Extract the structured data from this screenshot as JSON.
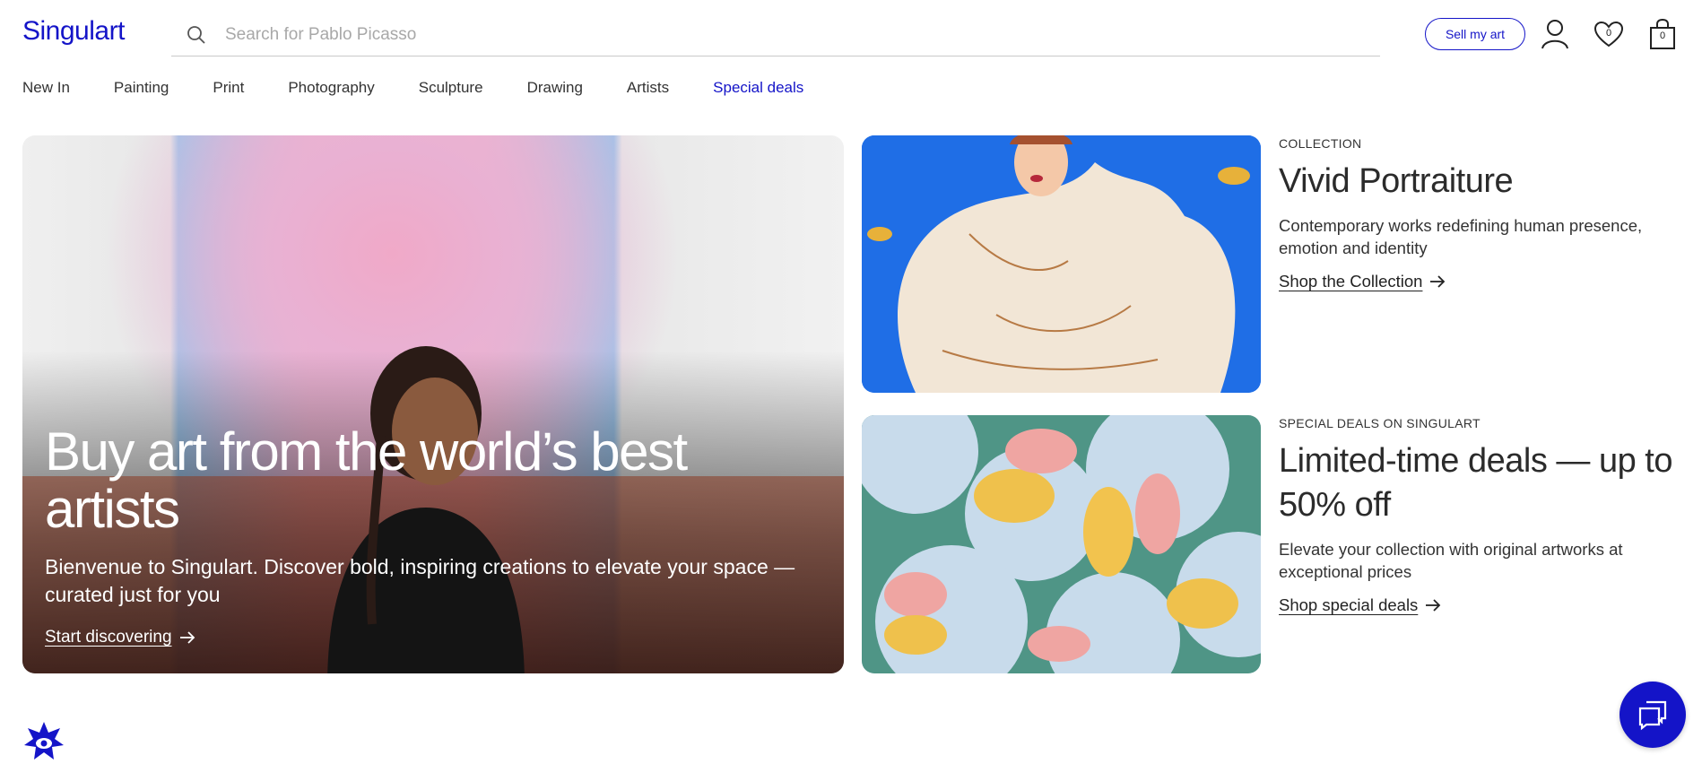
{
  "header": {
    "logo": "Singulart",
    "search_placeholder": "Search for Pablo Picasso",
    "sell_label": "Sell my art",
    "wishlist_count": "0",
    "cart_count": "0"
  },
  "nav": {
    "items": [
      "New In",
      "Painting",
      "Print",
      "Photography",
      "Sculpture",
      "Drawing",
      "Artists",
      "Special deals"
    ]
  },
  "hero": {
    "title": "Buy art from the world’s best artists",
    "subtitle": "Bienvenue to Singulart. Discover bold, inspiring creations to elevate your space —curated just for you",
    "link": "Start discovering"
  },
  "cards": [
    {
      "eyebrow": "COLLECTION",
      "title": "Vivid Portraiture",
      "description": "Contemporary works redefining human presence, emotion and identity",
      "link": "Shop the Collection"
    },
    {
      "eyebrow": "SPECIAL DEALS ON SINGULART",
      "title": "Limited-time deals — up to 50% off",
      "description": "Elevate your collection with original artworks at exceptional prices",
      "link": "Shop special deals"
    }
  ],
  "colors": {
    "brand": "#1414c8",
    "text": "#2b2b2b",
    "divider": "#c9c9c9"
  },
  "icons": {
    "search": "search-icon",
    "account": "user-icon",
    "wishlist": "heart-icon",
    "cart": "shopping-bag-icon",
    "chat": "chat-icon",
    "badge": "eye-star-icon",
    "arrow": "arrow-right-icon"
  }
}
